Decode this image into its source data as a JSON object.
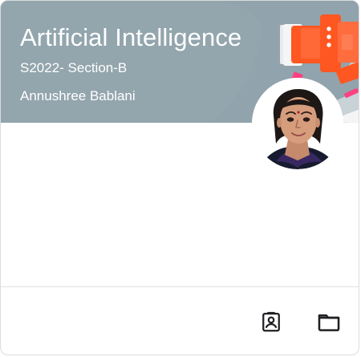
{
  "course_card": {
    "title": "Artificial Intelligence",
    "section": "S2022- Section-B",
    "teacher": "Annushree Bablani",
    "menu_icon": "more-vert-icon",
    "avatar_icon": "teacher-profile-photo",
    "actions": [
      {
        "name": "your-work-button",
        "icon": "assignment-ind-icon"
      },
      {
        "name": "class-drive-folder-button",
        "icon": "folder-icon"
      }
    ]
  },
  "colors": {
    "banner_background": "#93a5ad",
    "text_on_banner": "#ffffff",
    "accent_orange": "#ff5722",
    "accent_pink": "#ff4081",
    "icon_dark": "#202124",
    "divider": "#e0e0e0"
  }
}
